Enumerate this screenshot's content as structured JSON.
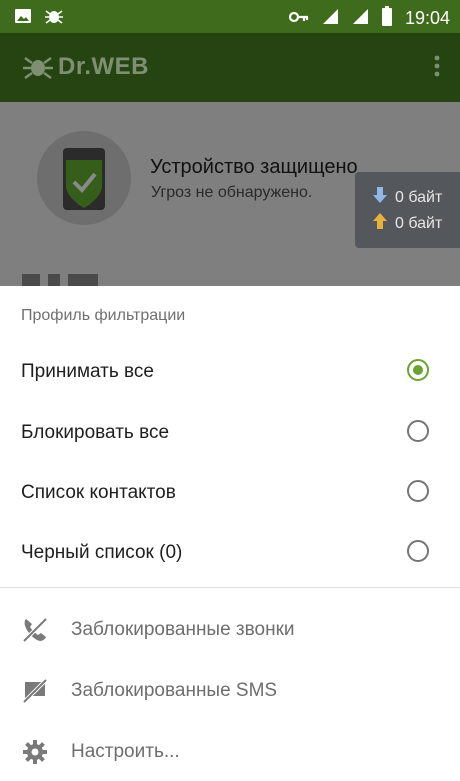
{
  "status_bar": {
    "time": "19:04",
    "left_icons": [
      "image-icon",
      "drweb-spider-icon"
    ],
    "right_icons": [
      "key-icon",
      "signal-icon",
      "signal-icon",
      "battery-icon"
    ]
  },
  "app_bar": {
    "logo_text": "Dr.WEB",
    "menu_icon": "more-vert-icon"
  },
  "background": {
    "status_title": "Устройство защищено",
    "status_subtitle": "Угроз не обнаружено.",
    "traffic_down": "0 байт",
    "traffic_up": "0 байт"
  },
  "sheet": {
    "title": "Профиль фильтрации",
    "options": [
      {
        "label": "Принимать все",
        "checked": true
      },
      {
        "label": "Блокировать все",
        "checked": false
      },
      {
        "label": "Список контактов",
        "checked": false
      },
      {
        "label": "Черный список (0)",
        "checked": false
      }
    ],
    "actions": [
      {
        "label": "Заблокированные звонки",
        "icon": "blocked-call-icon"
      },
      {
        "label": "Заблокированные SMS",
        "icon": "blocked-sms-icon"
      },
      {
        "label": "Настроить...",
        "icon": "gear-icon"
      }
    ]
  },
  "colors": {
    "accent": "#6aa330",
    "app_bar": "#264412",
    "status_bar": "#3f6b1d"
  }
}
